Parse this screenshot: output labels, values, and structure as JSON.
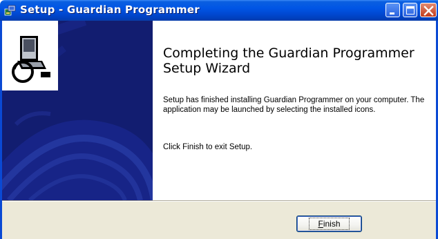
{
  "window": {
    "title": "Setup - Guardian Programmer",
    "icons": [
      "installer-icon",
      "minimize-icon",
      "maximize-icon",
      "close-icon"
    ]
  },
  "sidebar": {
    "image_icon": "computer-install-icon",
    "background_color": "#111c6e"
  },
  "main": {
    "heading": "Completing the Guardian Programmer Setup Wizard",
    "paragraph1": "Setup has finished installing Guardian Programmer on your computer. The application may be launched by selecting the installed icons.",
    "paragraph2": "Click Finish to exit Setup."
  },
  "buttons": {
    "finish_mnemonic": "F",
    "finish_rest": "inish"
  },
  "colors": {
    "titlebar": "#0055e5",
    "close_button": "#c43c1b",
    "dialog_bg": "#ece9d8"
  }
}
